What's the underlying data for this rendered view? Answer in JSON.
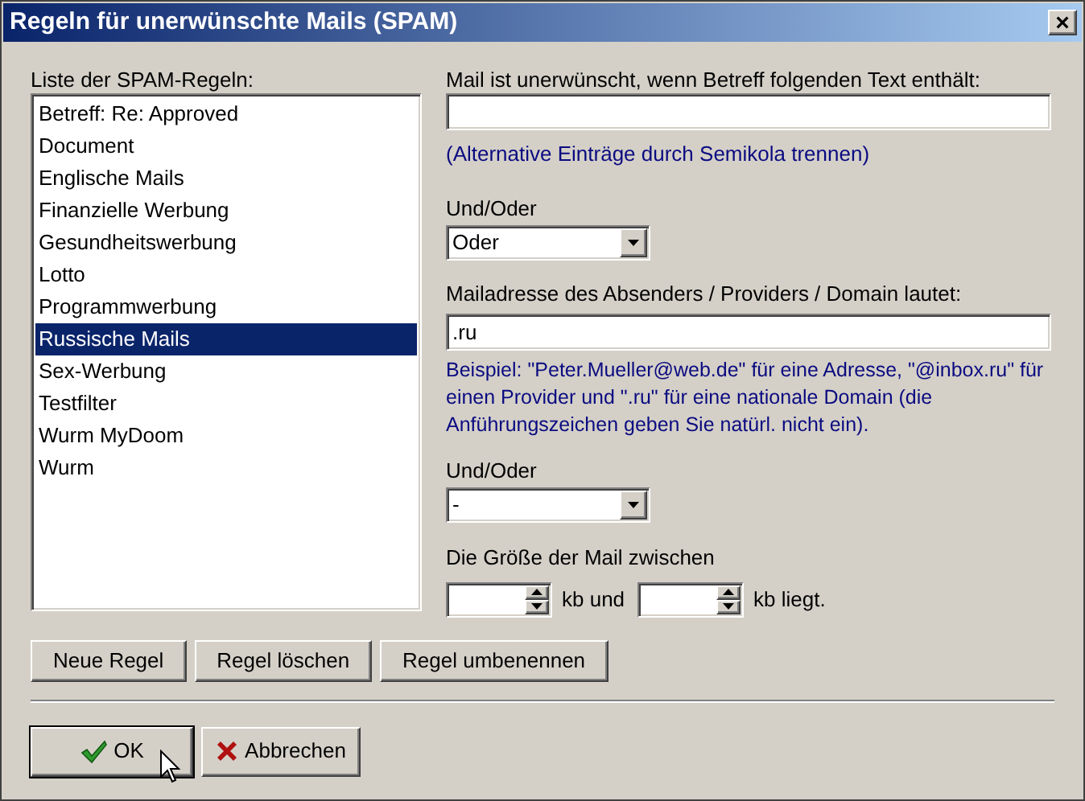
{
  "window": {
    "title": "Regeln für unerwünschte Mails (SPAM)",
    "close": "×"
  },
  "rules": {
    "label": "Liste der SPAM-Regeln:",
    "items": [
      {
        "label": "Betreff: Re: Approved",
        "selected": false
      },
      {
        "label": "Document",
        "selected": false
      },
      {
        "label": "Englische Mails",
        "selected": false
      },
      {
        "label": "Finanzielle Werbung",
        "selected": false
      },
      {
        "label": "Gesundheitswerbung",
        "selected": false
      },
      {
        "label": "Lotto",
        "selected": false
      },
      {
        "label": "Programmwerbung",
        "selected": false
      },
      {
        "label": "Russische Mails",
        "selected": true
      },
      {
        "label": "Sex-Werbung",
        "selected": false
      },
      {
        "label": "Testfilter",
        "selected": false
      },
      {
        "label": "Wurm MyDoom",
        "selected": false
      },
      {
        "label": "Wurm",
        "selected": false
      }
    ]
  },
  "subject": {
    "label": "Mail ist unerwünscht, wenn Betreff folgenden Text enthält:",
    "hint": "(Alternative Einträge durch Semikola trennen)"
  },
  "and_or_1": {
    "label": "Und/Oder",
    "value": "Oder"
  },
  "sender": {
    "label": "Mailadresse des Absenders / Providers / Domain lautet:",
    "value": ".ru",
    "hint": "Beispiel: \"Peter.Mueller@web.de\" für eine Adresse, \"@inbox.ru\" für einen Provider und \".ru\" für eine nationale Domain (die Anführungszeichen geben Sie natürl. nicht ein)."
  },
  "and_or_2": {
    "label": "Und/Oder",
    "value": "-"
  },
  "size": {
    "label": "Die Größe der Mail zwischen",
    "between": "kb und",
    "end": "kb liegt."
  },
  "rule_buttons": [
    "Neue Regel",
    "Regel löschen",
    "Regel umbenennen"
  ],
  "ok_button": "OK",
  "cancel_button": "Abbrechen"
}
